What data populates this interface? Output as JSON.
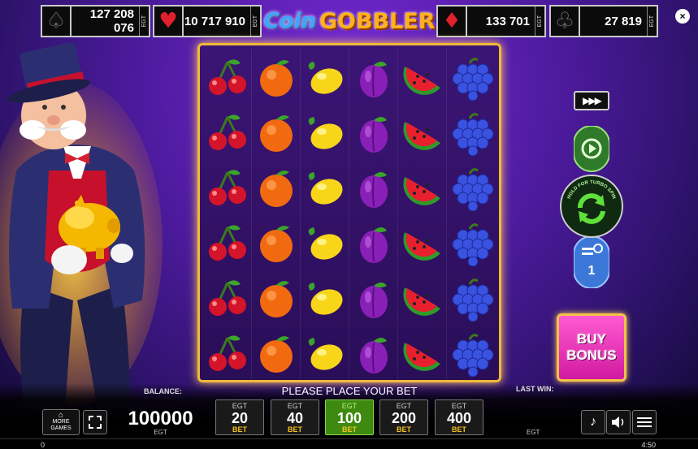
{
  "jackpots": [
    {
      "suit": "spade",
      "glyph": "♠",
      "value": "127 208 076",
      "brand": "EGT"
    },
    {
      "suit": "heart",
      "glyph": "♥",
      "value": "10 717 910",
      "brand": "EGT"
    },
    {
      "suit": "diamond",
      "glyph": "♦",
      "value": "133 701",
      "brand": "EGT"
    },
    {
      "suit": "club",
      "glyph": "♣",
      "value": "27 819",
      "brand": "EGT"
    }
  ],
  "logo": {
    "part1": "Coin",
    "part2": "GOBBLER"
  },
  "close_glyph": "×",
  "reels": [
    [
      "cherry",
      "cherry",
      "cherry",
      "cherry",
      "cherry",
      "cherry"
    ],
    [
      "orange",
      "orange",
      "orange",
      "orange",
      "orange",
      "orange"
    ],
    [
      "lemon",
      "lemon",
      "lemon",
      "lemon",
      "lemon",
      "lemon"
    ],
    [
      "plum",
      "plum",
      "plum",
      "plum",
      "plum",
      "plum"
    ],
    [
      "watermelon",
      "watermelon",
      "watermelon",
      "watermelon",
      "watermelon",
      "watermelon"
    ],
    [
      "grapes",
      "grapes",
      "grapes",
      "grapes",
      "grapes",
      "grapes"
    ]
  ],
  "controls": {
    "autoplay_glyph": "▶▶▶",
    "turbo_hint": "HOLD FOR TURBO SPIN",
    "auto_count": "1",
    "buy_bonus_label": "BUY\nBONUS"
  },
  "bottom": {
    "balance_label": "BALANCE:",
    "balance_value": "100000",
    "balance_currency": "EGT",
    "message": "PLEASE PLACE YOUR BET",
    "last_win_label": "LAST WIN:",
    "last_win_currency": "EGT",
    "more_games_label": "MORE\nGAMES",
    "footer_left": "0",
    "footer_right": "4:50",
    "bets": [
      {
        "top": "EGT",
        "value": "20",
        "bottom": "BET",
        "active": false
      },
      {
        "top": "EGT",
        "value": "40",
        "bottom": "BET",
        "active": false
      },
      {
        "top": "EGT",
        "value": "100",
        "bottom": "BET",
        "active": true
      },
      {
        "top": "EGT",
        "value": "200",
        "bottom": "BET",
        "active": false
      },
      {
        "top": "EGT",
        "value": "400",
        "bottom": "BET",
        "active": false
      }
    ]
  },
  "colors": {
    "accent_gold": "#f0b93a",
    "active_bet": "#3e8a10",
    "buy_bonus": "#d11aa0"
  }
}
